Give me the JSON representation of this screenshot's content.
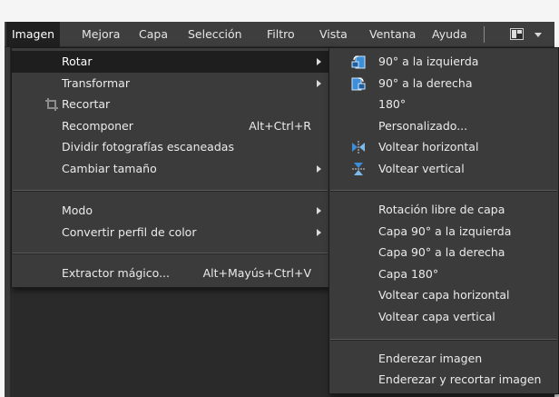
{
  "menubar": {
    "items": [
      "Imagen",
      "Mejora",
      "Capa",
      "Selección",
      "Filtro",
      "Vista",
      "Ventana",
      "Ayuda"
    ],
    "active_index": 0
  },
  "main_menu": {
    "items": [
      {
        "label": "Rotar",
        "shortcut": "",
        "submenu": true,
        "highlighted": true
      },
      {
        "label": "Transformar",
        "shortcut": "",
        "submenu": true
      },
      {
        "label": "Recortar",
        "shortcut": "",
        "icon": "crop-icon"
      },
      {
        "label": "Recomponer",
        "shortcut": "Alt+Ctrl+R"
      },
      {
        "label": "Dividir fotografías escaneadas",
        "shortcut": ""
      },
      {
        "label": "Cambiar tamaño",
        "shortcut": "",
        "submenu": true
      },
      {
        "label": "Modo",
        "shortcut": "",
        "submenu": true
      },
      {
        "label": "Convertir perfil de color",
        "shortcut": "",
        "submenu": true
      },
      {
        "label": "Extractor mágico...",
        "shortcut": "Alt+Mayús+Ctrl+V"
      }
    ]
  },
  "rotate_submenu": {
    "items": [
      {
        "label": "90° a la izquierda",
        "icon": "rotate-left-icon"
      },
      {
        "label": "90° a la derecha",
        "icon": "rotate-right-icon"
      },
      {
        "label": "180°"
      },
      {
        "label": "Personalizado..."
      },
      {
        "label": "Voltear horizontal",
        "icon": "flip-horizontal-icon"
      },
      {
        "label": "Voltear vertical",
        "icon": "flip-vertical-icon"
      },
      {
        "label": "Rotación libre de capa"
      },
      {
        "label": "Capa 90° a la izquierda"
      },
      {
        "label": "Capa 90° a la derecha"
      },
      {
        "label": "Capa 180°"
      },
      {
        "label": "Voltear capa horizontal"
      },
      {
        "label": "Voltear capa vertical"
      },
      {
        "label": "Enderezar imagen"
      },
      {
        "label": "Enderezar y recortar imagen"
      }
    ]
  },
  "colors": {
    "menubar_bg": "#3e3e3e",
    "menu_bg": "#3b3b3b",
    "highlight_bg": "#1e1e1e",
    "icon_blue": "#3d8ed8"
  }
}
